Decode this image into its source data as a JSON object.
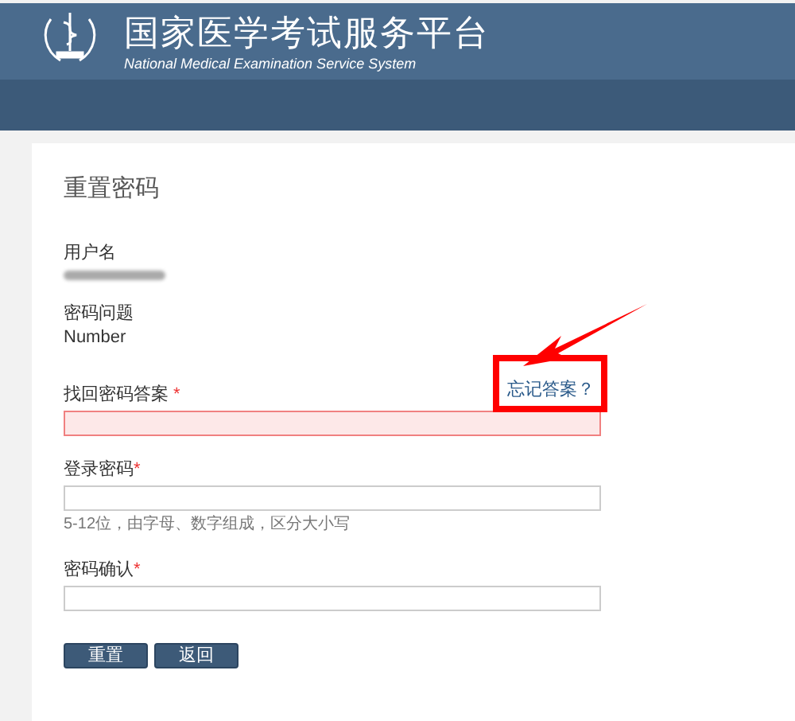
{
  "header": {
    "title": "国家医学考试服务平台",
    "subtitle": "National Medical Examination Service System"
  },
  "form": {
    "title": "重置密码",
    "info": [
      {
        "label": "用户名",
        "redacted": true
      },
      {
        "label": "密码问题",
        "value": "Number",
        "redacted": false
      }
    ],
    "inputs": [
      {
        "label": "找回密码答案",
        "mark": " *",
        "error": true,
        "link": {
          "text": "忘记答案？",
          "highlighted": true
        }
      },
      {
        "label": "登录密码",
        "mark": "*",
        "error": false,
        "hint": "5-12位，由字母、数字组成，区分大小写"
      },
      {
        "label": "密码确认",
        "mark": "*",
        "error": false
      }
    ],
    "buttons": [
      "重置",
      "返回"
    ]
  }
}
